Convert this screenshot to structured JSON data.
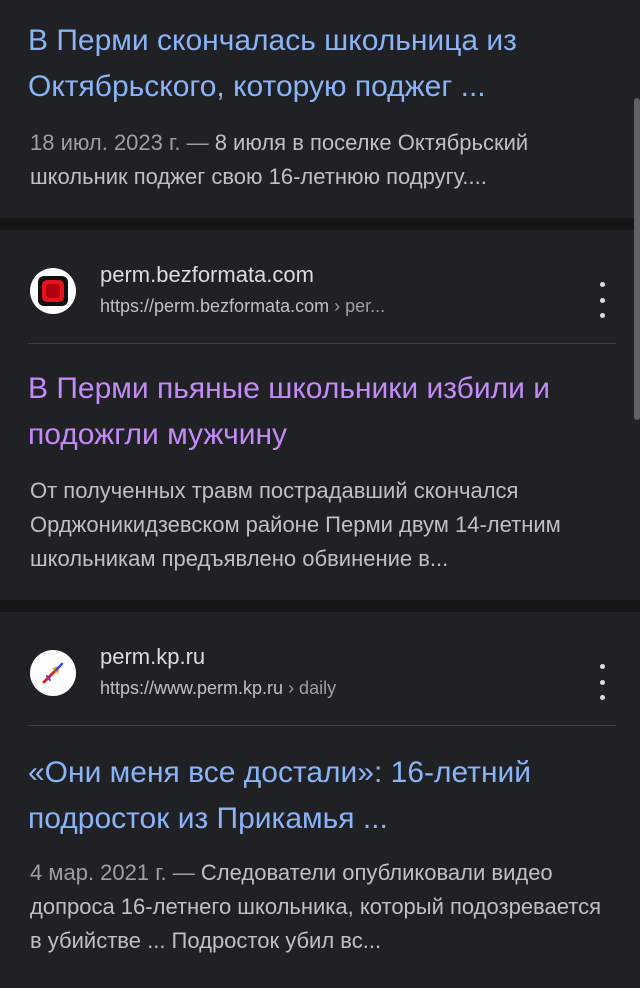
{
  "results": [
    {
      "title": "В Перми скончалась школьница из Октябрьского, которую поджег ...",
      "date": "18 июл. 2023 г. — ",
      "snippet": "8 июля в поселке Октябрьский школьник поджег свою 16-летнюю подругу...."
    },
    {
      "site_name": "perm.bezformata.com",
      "url": "https://perm.bezformata.com",
      "url_path": " › per...",
      "favicon": "bezformata-logo-icon",
      "title": "В Перми пьяные школьники избили и подожгли мужчину",
      "snippet": "От полученных травм пострадавший скончался Орджоникидзевском районе Перми двум 14-летним школьникам предъявлено обвинение в..."
    },
    {
      "site_name": "perm.kp.ru",
      "url": "https://www.perm.kp.ru",
      "url_path": " › daily",
      "favicon": "kp-logo-icon",
      "title": "«Они меня все достали»: 16-летний подросток из Прикамья ...",
      "date": "4 мар. 2021 г. — ",
      "snippet": "Следователи опубликовали видео допроса 16-летнего школьника, который подозревается в убийстве ... Подросток убил вс..."
    }
  ],
  "colors": {
    "background": "#161617",
    "card": "#202124",
    "link": "#8ab4f8",
    "visited_link": "#c58af9",
    "snippet": "#bdc1c6",
    "muted": "#9aa0a6"
  }
}
